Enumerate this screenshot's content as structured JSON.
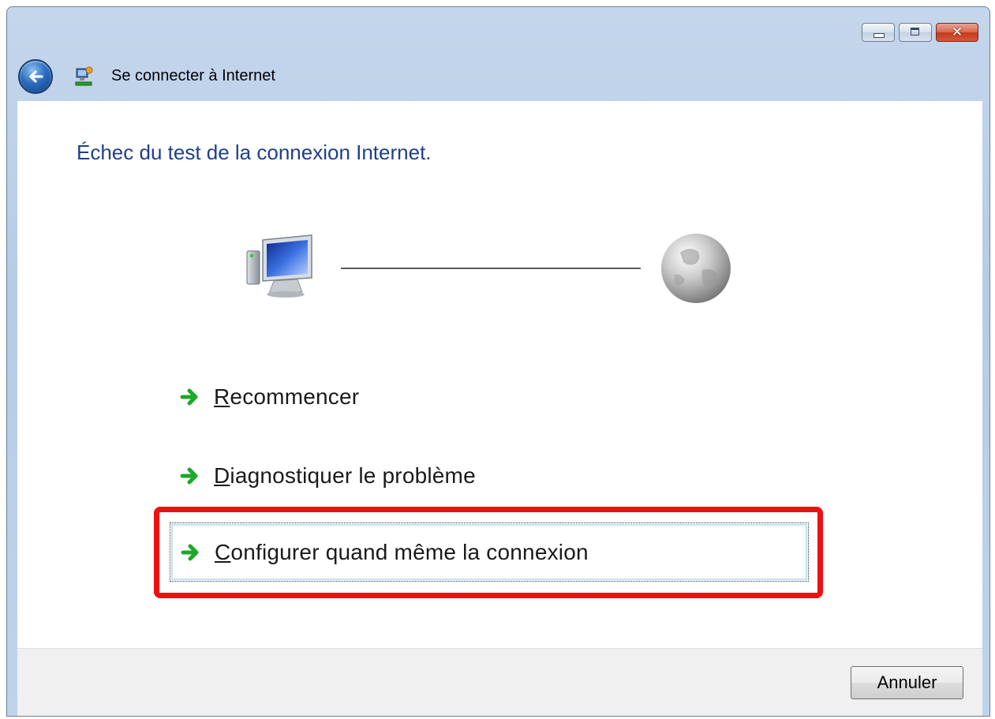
{
  "window": {
    "title": "Se connecter à Internet",
    "controls": {
      "minimize_icon": "minimize-icon",
      "maximize_icon": "maximize-icon",
      "close_icon": "close-icon",
      "close_glyph": "✕"
    },
    "back_icon": "back-arrow-icon",
    "app_icon": "network-wizard-icon"
  },
  "main": {
    "heading": "Échec du test de la connexion Internet.",
    "diagram": {
      "left_icon": "computer-icon",
      "right_icon": "globe-icon"
    },
    "commands": [
      {
        "access_key": "R",
        "rest": "ecommencer",
        "icon": "green-arrow-icon"
      },
      {
        "access_key": "D",
        "rest": "iagnostiquer le problème",
        "icon": "green-arrow-icon"
      },
      {
        "access_key": "C",
        "rest": "onfigurer quand même la connexion",
        "icon": "green-arrow-icon",
        "focused": true,
        "highlighted": true
      }
    ]
  },
  "footer": {
    "cancel_label": "Annuler"
  },
  "colors": {
    "heading": "#1e3f8a",
    "highlight": "#ee1111",
    "arrow": "#1fa82a",
    "titlebar": "#b6cce6"
  }
}
